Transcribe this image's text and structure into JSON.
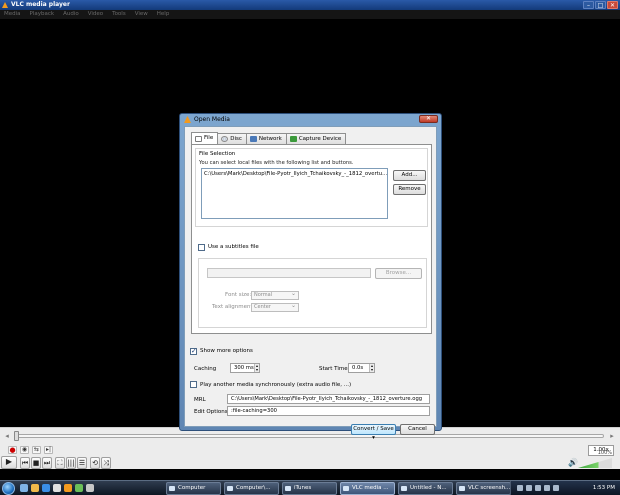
{
  "app": {
    "title": "VLC media player",
    "menu": [
      "Media",
      "Playback",
      "Audio",
      "Video",
      "Tools",
      "View",
      "Help"
    ],
    "window_buttons": [
      "–",
      "□",
      "✕"
    ]
  },
  "controls": {
    "seek_back_glyph": "◂",
    "seek_fwd_glyph": "▸",
    "play_glyph": "▶",
    "prev_glyph": "⏮",
    "stop_glyph": "■",
    "next_glyph": "⏭",
    "fullscreen_glyph": "⛶",
    "playlist_glyph": "☰",
    "extended_glyph": "|||",
    "loop_glyph": "⟲",
    "shuffle_glyph": "⤨",
    "record_glyph": "●",
    "snapshot_glyph": "◉",
    "abloop_glyph": "⇆",
    "frame_glyph": "▸|",
    "speed": "1.00x",
    "volume_percent": "100%",
    "volume_level": 0.6
  },
  "dialog": {
    "title": "Open Media",
    "close_glyph": "✕",
    "tabs": [
      {
        "label": "File",
        "icon": "file-icon"
      },
      {
        "label": "Disc",
        "icon": "disc-icon"
      },
      {
        "label": "Network",
        "icon": "network-icon"
      },
      {
        "label": "Capture Device",
        "icon": "capture-device-icon"
      }
    ],
    "file_selection": {
      "legend": "File Selection",
      "description": "You can select local files with the following list and buttons.",
      "files": [
        "C:\\Users\\Mark\\Desktop\\File-Pyotr_Ilyich_Tchaikovsky_-_1812_overtu..."
      ],
      "add_label": "Add...",
      "remove_label": "Remove"
    },
    "subtitles": {
      "checkbox_label": "Use a subtitles file",
      "checked": false,
      "browse_label": "Browse...",
      "font_size_label": "Font size:",
      "font_size_value": "Normal",
      "alignment_label": "Text alignment:",
      "alignment_value": "Center"
    },
    "options": {
      "show_more_label": "Show more options",
      "show_more_checked": true,
      "caching_label": "Caching",
      "caching_value": "300 ms",
      "start_time_label": "Start Time",
      "start_time_value": "0.0s",
      "play_another_label": "Play another media synchronously (extra audio file, ...)",
      "play_another_checked": false,
      "mrl_label": "MRL",
      "mrl_value": "C:\\Users\\Mark\\Desktop\\File-Pyotr_Ilyich_Tchaikovsky_-_1812_overture.ogg",
      "edit_options_label": "Edit Options",
      "edit_options_value": ":file-caching=300"
    },
    "convert_label": "Convert / Save",
    "cancel_label": "Cancel"
  },
  "taskbar": {
    "tasks": [
      "Computer",
      "Computer\\...",
      "iTunes",
      "VLC media ...",
      "Untitled - N...",
      "VLC screensh..."
    ],
    "active_task": 3,
    "clock": "1:53 PM"
  }
}
